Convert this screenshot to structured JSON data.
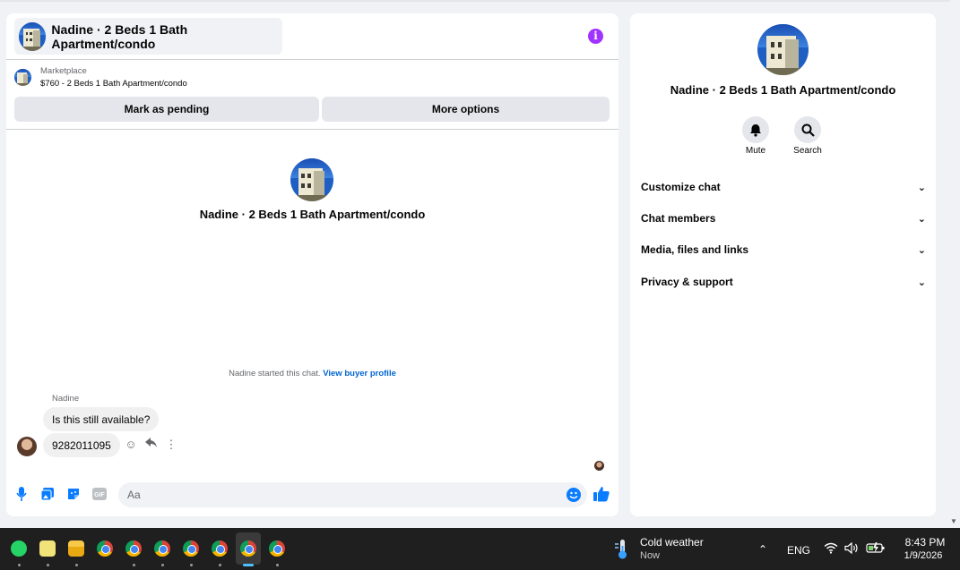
{
  "chat": {
    "title": "Nadine · 2 Beds 1 Bath Apartment/condo",
    "info_icon": "info-icon",
    "marketplace_label": "Marketplace",
    "listing": "$760 - 2 Beds 1 Bath Apartment/condo",
    "mark_pending_label": "Mark as pending",
    "more_options_label": "More options",
    "center_title": "Nadine · 2 Beds 1 Bath Apartment/condo",
    "started_text": "Nadine started this chat.",
    "buyer_profile_link": "View buyer profile",
    "sender_name": "Nadine",
    "messages": [
      {
        "text": "Is this still available?"
      },
      {
        "text": "9282011095"
      }
    ],
    "compose_placeholder": "Aa",
    "accent_color": "#0a7cff"
  },
  "sidebar": {
    "title": "Nadine · 2 Beds 1 Bath Apartment/condo",
    "mute_label": "Mute",
    "search_label": "Search",
    "sections": [
      {
        "label": "Customize chat"
      },
      {
        "label": "Chat members"
      },
      {
        "label": "Media, files and links"
      },
      {
        "label": "Privacy & support"
      }
    ]
  },
  "taskbar": {
    "apps": [
      "whatsapp-icon",
      "notepad-icon",
      "file-explorer-icon",
      "chrome-icon",
      "chrome-profile-icon",
      "chrome-profile-icon",
      "chrome-profile-icon",
      "chrome-profile-icon",
      "chrome-profile-icon",
      "chrome-profile-icon"
    ],
    "weather_title": "Cold weather",
    "weather_sub": "Now",
    "language": "ENG",
    "time": "8:43 PM",
    "date": "1/9/2026"
  }
}
